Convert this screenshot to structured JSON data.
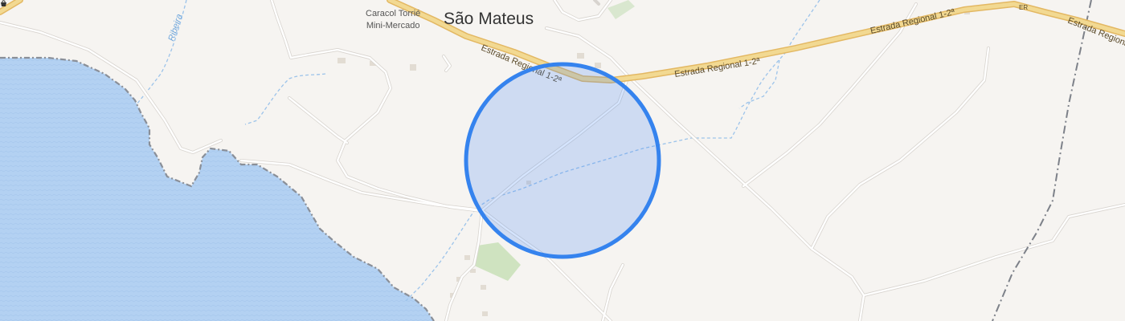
{
  "map": {
    "place_label": "São Mateus",
    "poi": {
      "name_line1": "Caracol Torrié",
      "name_line2": "Mini-Mercado",
      "icon": "shop-icon"
    },
    "stream_label": "Ribeira",
    "road_labels": [
      {
        "text": "Estrada Regional 1-2ª"
      },
      {
        "text": "Estrada Regional 1-2ª"
      },
      {
        "text": "Estrada Regional 1-2ª"
      },
      {
        "text": "Estrada Regional 1-2ª"
      },
      {
        "text": "Estrada Re"
      },
      {
        "text": "ER"
      }
    ],
    "colors": {
      "land": "#f6f4f1",
      "water": "#b3d1f2",
      "coastline": "#8a8f98",
      "major_road_fill": "#f2d992",
      "major_road_casing": "#e3b863",
      "minor_road": "#ffffff",
      "minor_road_casing": "#d8d4cf",
      "stream": "#9cc3ea",
      "green_area": "#cfe3c0",
      "boundary": "#7d8189",
      "location_fill": "rgba(66,133,244,0.22)",
      "location_stroke": "#3583ee"
    },
    "location_marker": {
      "type": "accuracy-circle"
    }
  }
}
